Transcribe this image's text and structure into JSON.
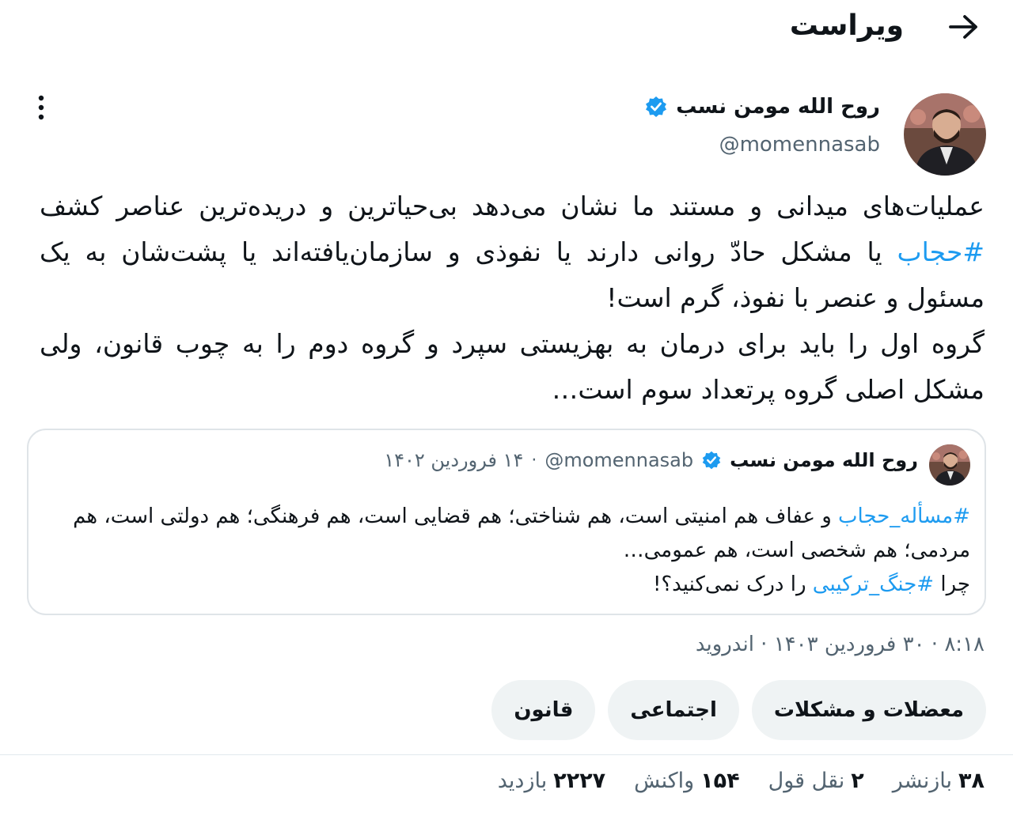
{
  "header": {
    "title": "ویراست",
    "back_icon": "arrow-right-icon"
  },
  "author": {
    "name": "روح الله مومن نسب",
    "handle": "@momennasab",
    "verified": true
  },
  "tweet": {
    "paragraph1_pre": "عملیات‌های میدانی و مستند ما نشان می‌دهد بی‌حیاترین و دریده‌ترین عناصر کشف ",
    "hashtag": "#حجاب",
    "paragraph1_post": " یا مشکل حادّ روانی دارند یا نفوذی و سازمان‌یافته‌اند یا پشت‌شان به یک مسئول و عنصر با نفوذ، گرم است!",
    "paragraph2": "گروه اول را باید برای درمان به بهزیستی سپرد و گروه دوم را به چوب قانون، ولی مشکل اصلی گروه پرتعداد سوم است…"
  },
  "quote": {
    "name": "روح الله مومن نسب",
    "handle": "@momennasab",
    "separator": "·",
    "date": "۱۴ فروردین ۱۴۰۲",
    "hashtag1": "#مسأله_حجاب",
    "line1_post": " و عفاف هم امنیتی است، هم شناختی؛ هم قضایی است، هم فرهنگی؛ هم دولتی است، هم مردمی؛ هم شخصی است، هم عمومی…",
    "line2_pre": "چرا ",
    "hashtag2": "#جنگ_ترکیبی",
    "line2_post": " را درک نمی‌کنید؟!"
  },
  "meta": {
    "text": "۸:۱۸ · ۳۰ فروردین ۱۴۰۳ · اندروید"
  },
  "tags": [
    "معضلات و مشکلات",
    "اجتماعی",
    "قانون"
  ],
  "stats": [
    {
      "num": "۳۸",
      "label": "بازنشر"
    },
    {
      "num": "۲",
      "label": "نقل قول"
    },
    {
      "num": "۱۵۴",
      "label": "واکنش"
    },
    {
      "num": "۲۲۲۷",
      "label": "بازدید"
    }
  ],
  "colors": {
    "accent": "#1d9bf0",
    "secondary_text": "#536471",
    "tag_bg": "#eff3f4"
  }
}
